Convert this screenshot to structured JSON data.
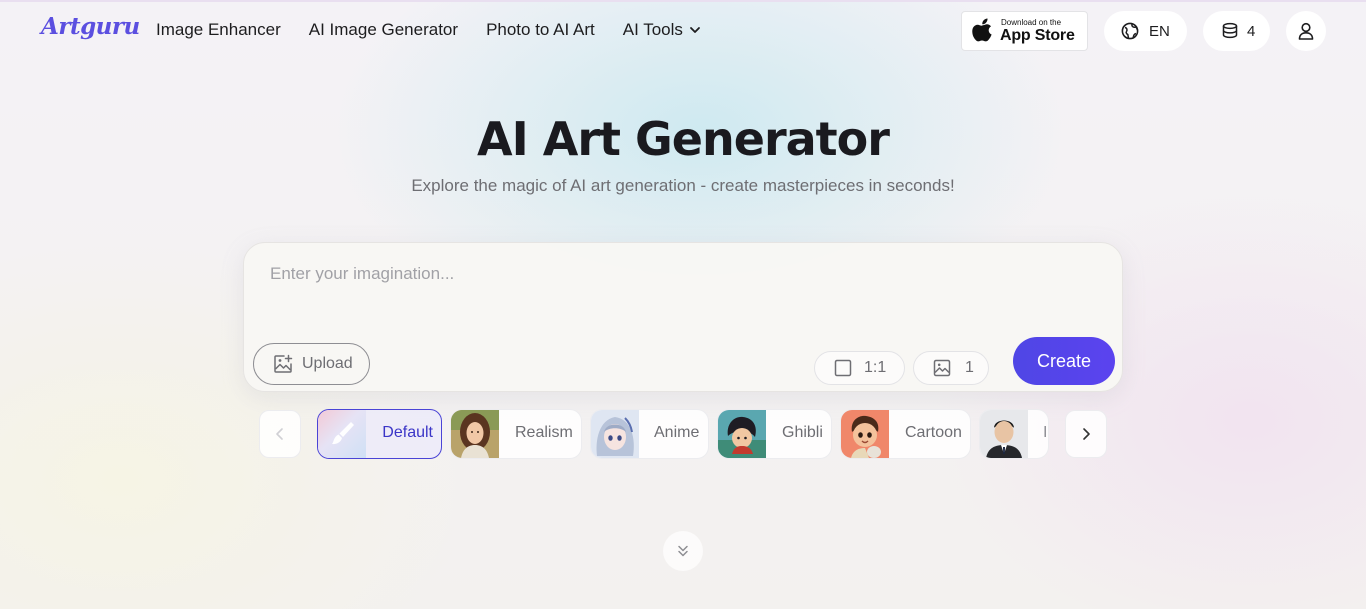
{
  "header": {
    "logo": "Artguru",
    "nav": [
      {
        "label": "Image Enhancer"
      },
      {
        "label": "AI Image Generator"
      },
      {
        "label": "Photo to AI Art"
      },
      {
        "label": "AI Tools"
      }
    ],
    "app_store": {
      "small_text": "Download on the",
      "big_text": "App Store"
    },
    "language": "EN",
    "credits": "4"
  },
  "hero": {
    "title": "AI Art Generator",
    "subtitle": "Explore the magic of AI art generation - create masterpieces in seconds!"
  },
  "prompt": {
    "placeholder": "Enter your imagination...",
    "value": "",
    "upload_label": "Upload",
    "ratio": "1:1",
    "image_count": "1",
    "create_label": "Create"
  },
  "styles": [
    {
      "label": "Default",
      "selected": true
    },
    {
      "label": "Realism",
      "selected": false
    },
    {
      "label": "Anime",
      "selected": false
    },
    {
      "label": "Ghibli",
      "selected": false
    },
    {
      "label": "Cartoon",
      "selected": false
    },
    {
      "label": "I",
      "selected": false
    }
  ],
  "colors": {
    "accent": "#4f46e5",
    "logo": "#5b4fe0",
    "text_primary": "#1d1d1f",
    "text_secondary": "#6e6e73"
  },
  "icons": {
    "apple": "apple-icon",
    "globe": "globe-icon",
    "credits": "coins-stack-icon",
    "account": "user-icon",
    "upload": "image-upload-icon",
    "ratio": "square-icon",
    "count": "image-icon",
    "prev": "chevron-left-icon",
    "next": "chevron-right-icon",
    "scroll": "double-chevron-down-icon"
  }
}
